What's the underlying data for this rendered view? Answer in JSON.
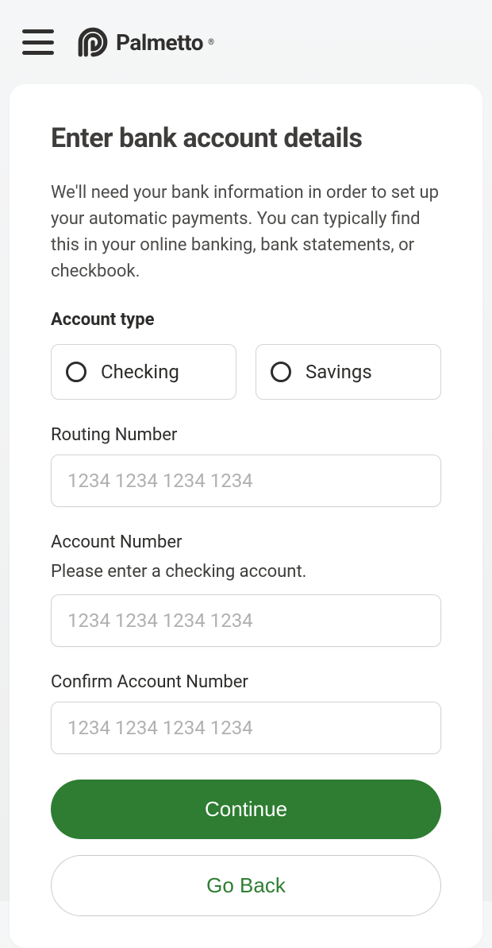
{
  "header": {
    "brand": "Palmetto"
  },
  "form": {
    "title": "Enter bank account details",
    "description": "We'll need your bank information in order to set up your automatic payments. You can typically find this in your online banking, bank statements, or checkbook.",
    "account_type": {
      "label": "Account type",
      "options": {
        "checking": "Checking",
        "savings": "Savings"
      }
    },
    "routing": {
      "label": "Routing Number",
      "placeholder": "1234 1234 1234 1234"
    },
    "account": {
      "label": "Account Number",
      "hint": "Please enter a checking account.",
      "placeholder": "1234 1234 1234 1234"
    },
    "confirm": {
      "label": "Confirm Account Number",
      "placeholder": "1234 1234 1234 1234"
    },
    "buttons": {
      "continue": "Continue",
      "go_back": "Go Back"
    }
  }
}
